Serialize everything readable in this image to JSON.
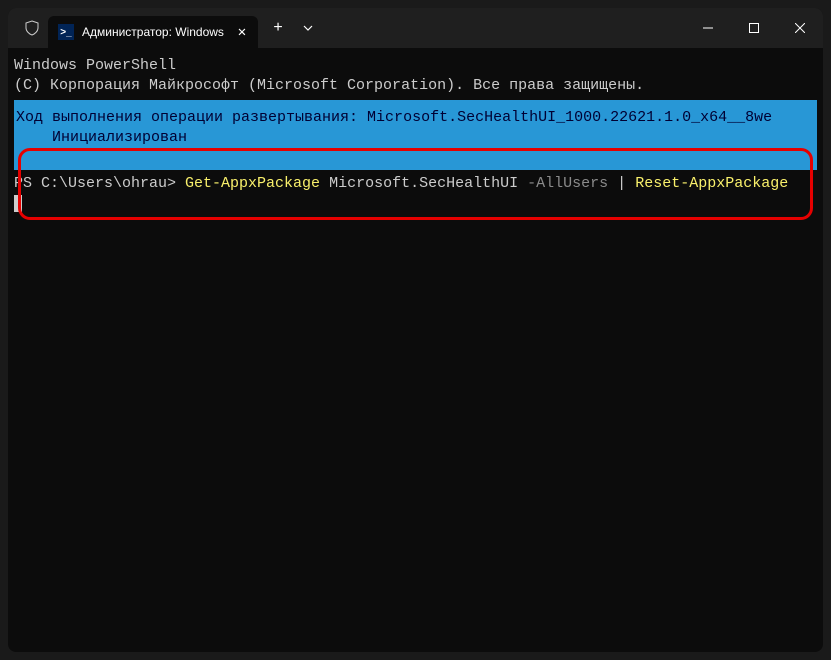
{
  "titlebar": {
    "tab_title": "Администратор: Windows Po",
    "new_tab_symbol": "+",
    "dropdown_symbol": "⌄",
    "minimize_symbol": "—",
    "maximize_symbol": "▢",
    "close_symbol": "✕",
    "tab_close_symbol": "✕",
    "ps_icon_text": ">_"
  },
  "terminal": {
    "line1": "Windows PowerShell",
    "line2": "(C) Корпорация Майкрософт (Microsoft Corporation). Все права защищены.",
    "progress_line1": "Ход выполнения операции развертывания: Microsoft.SecHealthUI_1000.22621.1.0_x64__8we",
    "progress_line2": "    Инициализирован",
    "prompt_prefix": "PS C:\\Users\\ohrau> ",
    "cmd_part1": "Get-AppxPackage",
    "cmd_space1": " ",
    "cmd_arg1": "Microsoft.SecHealthUI",
    "cmd_space2": " ",
    "cmd_flag": "-AllUsers",
    "cmd_space3": " ",
    "cmd_pipe": "|",
    "cmd_space4": " ",
    "cmd_part2": "Reset-AppxPackage"
  }
}
